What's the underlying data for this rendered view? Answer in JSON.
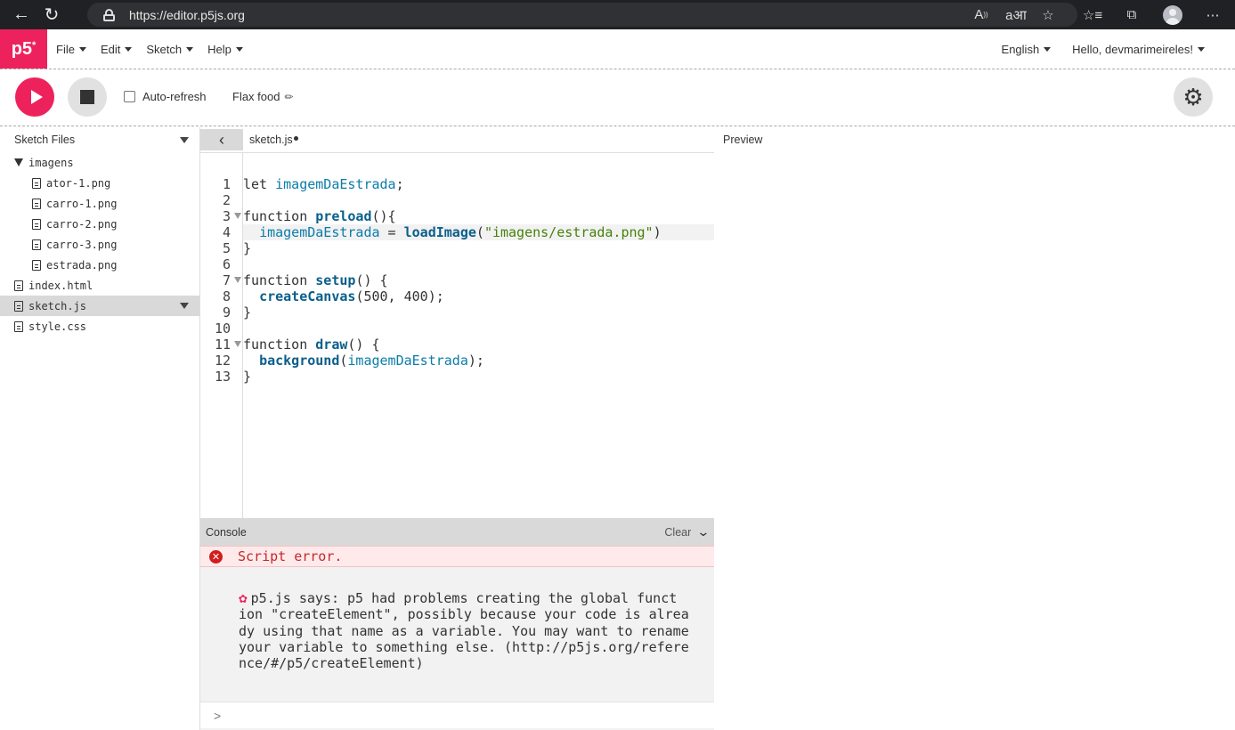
{
  "browser": {
    "url": "https://editor.p5js.org",
    "icons": [
      "back-arrow-icon",
      "refresh-icon",
      "lock-icon",
      "read-aloud-icon",
      "translate-icon",
      "add-favorite-icon",
      "favorites-icon",
      "collections-icon",
      "profile-icon",
      "more-icon"
    ]
  },
  "menu": {
    "logo": "p5",
    "logo_sup": "*",
    "file": "File",
    "edit": "Edit",
    "sketch": "Sketch",
    "help": "Help",
    "language": "English",
    "user": "Hello, devmarimeireles!"
  },
  "toolbar": {
    "auto_refresh": "Auto-refresh",
    "sketch_name": "Flax food"
  },
  "sidebar": {
    "title": "Sketch Files",
    "folder": "imagens",
    "images": [
      "ator-1.png",
      "carro-1.png",
      "carro-2.png",
      "carro-3.png",
      "estrada.png"
    ],
    "root_files": [
      "index.html",
      "sketch.js",
      "style.css"
    ],
    "selected": "sketch.js"
  },
  "editor": {
    "tab": "sketch.js",
    "line_numbers": [
      "1",
      "2",
      "3",
      "4",
      "5",
      "6",
      "7",
      "8",
      "9",
      "10",
      "11",
      "12",
      "13"
    ],
    "code": [
      "let imagemDaEstrada;",
      "",
      "function preload(){",
      "  imagemDaEstrada = loadImage(\"imagens/estrada.png\")",
      "}",
      "",
      "function setup() {",
      "  createCanvas(500, 400);",
      "}",
      "",
      "function draw() {",
      "  background(imagemDaEstrada);",
      "}"
    ]
  },
  "console": {
    "title": "Console",
    "clear": "Clear",
    "error": "Script error.",
    "message_lines": [
      "p5.js says: p5 had problems creating the global funct",
      "ion \"createElement\", possibly because your code is alrea",
      "dy using that name as a variable. You may want to rename",
      "your variable to something else. (http://p5js.org/refere",
      "nce/#/p5/createElement)"
    ],
    "prompt": ">"
  },
  "preview": {
    "label": "Preview"
  }
}
